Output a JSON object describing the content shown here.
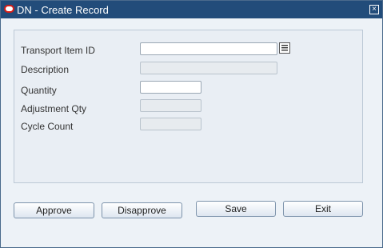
{
  "window": {
    "title": "DN - Create Record",
    "close_glyph": "×"
  },
  "form": {
    "transport_item_id": {
      "label": "Transport Item ID",
      "value": ""
    },
    "description": {
      "label": "Description",
      "value": ""
    },
    "quantity": {
      "label": "Quantity",
      "value": ""
    },
    "adjustment_qty": {
      "label": "Adjustment Qty",
      "value": ""
    },
    "cycle_count": {
      "label": "Cycle Count",
      "value": ""
    }
  },
  "buttons": {
    "approve": "Approve",
    "disapprove": "Disapprove",
    "save": "Save",
    "exit": "Exit"
  },
  "icons": {
    "app": "oracle-icon",
    "lov": "list-of-values-icon",
    "close": "close-icon"
  },
  "colors": {
    "titlebar": "#224c7a",
    "background": "#edf2f7",
    "brand": "#d61c16"
  }
}
